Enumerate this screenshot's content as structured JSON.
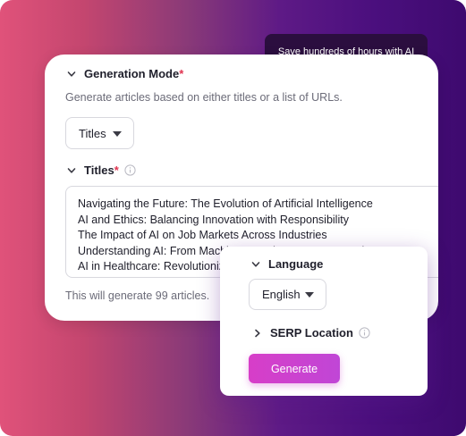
{
  "toast": {
    "text": "Save hundreds of hours with AI"
  },
  "generation_mode": {
    "label": "Generation Mode",
    "required_mark": "*",
    "description": "Generate articles based on either titles or a list of URLs.",
    "selected": "Titles"
  },
  "titles": {
    "label": "Titles",
    "required_mark": "*",
    "lines": [
      "Navigating the Future: The Evolution of Artificial Intelligence",
      "AI and Ethics: Balancing Innovation with Responsibility",
      "The Impact of AI on Job Markets Across Industries",
      "Understanding AI: From Machine Learning to Deep Learning",
      "AI in Healthcare: Revolutionizing Patient Care"
    ],
    "note": "This will generate 99 articles."
  },
  "language": {
    "label": "Language",
    "selected": "English"
  },
  "serp_location": {
    "label": "SERP Location"
  },
  "generate_button": {
    "label": "Generate"
  },
  "colors": {
    "accent": "#d03fd0",
    "required": "#e0334f",
    "toast_bg": "#2b0e3f"
  },
  "icons": [
    "chevron-down-icon",
    "chevron-right-icon",
    "info-icon",
    "caret-down-icon"
  ]
}
